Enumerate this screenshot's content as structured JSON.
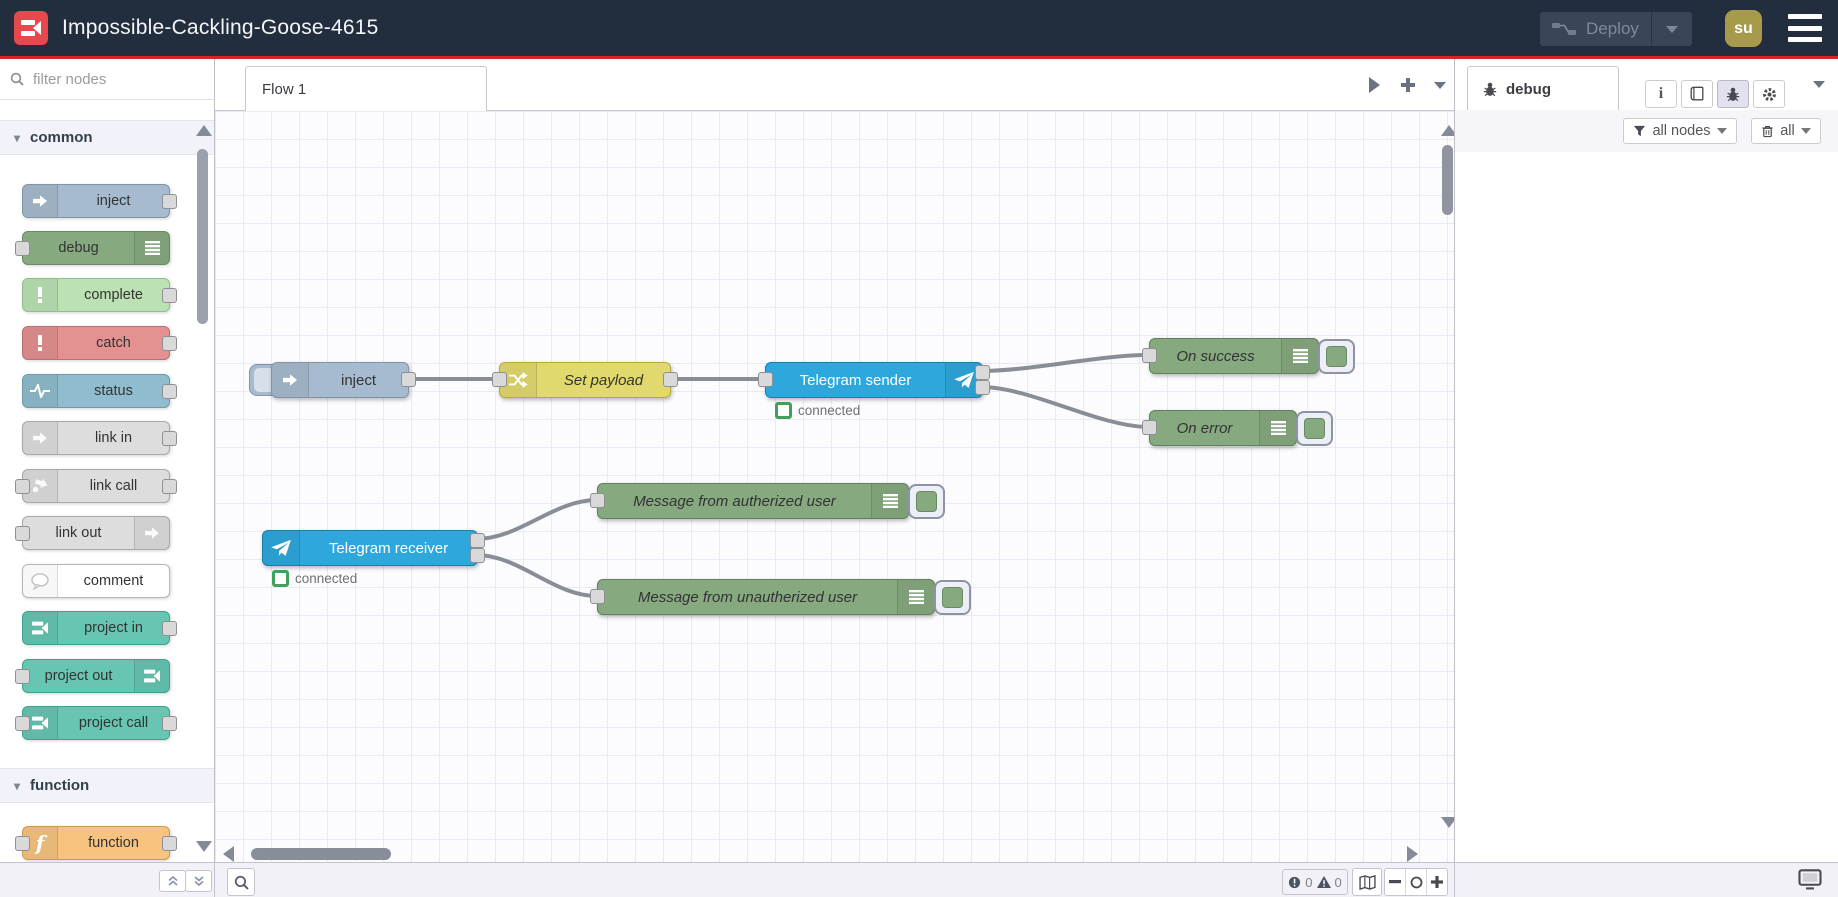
{
  "header": {
    "title": "Impossible-Cackling-Goose-4615",
    "deploy_label": "Deploy",
    "avatar_label": "su"
  },
  "palette": {
    "filter_placeholder": "filter nodes",
    "categories": [
      {
        "label": "common",
        "nodes": [
          {
            "label": "inject"
          },
          {
            "label": "debug"
          },
          {
            "label": "complete"
          },
          {
            "label": "catch"
          },
          {
            "label": "status"
          },
          {
            "label": "link in"
          },
          {
            "label": "link call"
          },
          {
            "label": "link out"
          },
          {
            "label": "comment"
          },
          {
            "label": "project in"
          },
          {
            "label": "project out"
          },
          {
            "label": "project call"
          }
        ]
      },
      {
        "label": "function",
        "nodes": [
          {
            "label": "function"
          }
        ]
      }
    ]
  },
  "workspace": {
    "tab": "Flow 1",
    "flow": {
      "inject": {
        "label": "inject"
      },
      "set_payload": {
        "label": "Set payload"
      },
      "telegram_sender": {
        "label": "Telegram sender",
        "status": "connected"
      },
      "on_success": {
        "label": "On success"
      },
      "on_error": {
        "label": "On error"
      },
      "telegram_receiver": {
        "label": "Telegram receiver",
        "status": "connected"
      },
      "msg_auth": {
        "label": "Message from autherized user"
      },
      "msg_unauth": {
        "label": "Message from unautherized user"
      }
    }
  },
  "debug_panel": {
    "tab": "debug",
    "filter_label": "all nodes",
    "clear_label": "all"
  },
  "footer": {
    "error_count": "0",
    "warning_count": "0"
  },
  "colors": {
    "header_bg": "#222d3d",
    "accent_red": "#cf2626",
    "telegram_blue": "#2ea8dc",
    "debug_green": "#87a980",
    "change_yellow": "#e2d96e",
    "inject_blue_gray": "#a6bbcf",
    "project_teal": "#66c6b2",
    "function_orange": "#f6c480",
    "status_ok_green": "#42a05c"
  }
}
